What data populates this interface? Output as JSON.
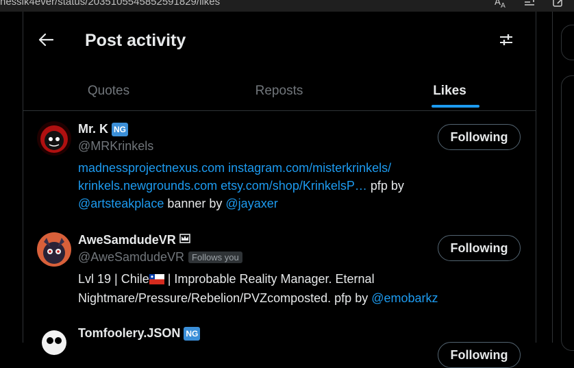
{
  "browser": {
    "url": "nessik4ever/status/2035105545852591829/likes",
    "icons": [
      "translate-icon",
      "read-aloud-icon",
      "edit-icon"
    ]
  },
  "header": {
    "title": "Post activity",
    "back_icon": "arrow-left-icon",
    "filter_icon": "sliders-icon"
  },
  "tabs": [
    {
      "label": "Quotes",
      "active": false
    },
    {
      "label": "Reposts",
      "active": false
    },
    {
      "label": "Likes",
      "active": true
    }
  ],
  "colors": {
    "accent": "#1d9bf0",
    "badge": "#3b8fd8",
    "background": "#000000"
  },
  "users": [
    {
      "name": "Mr. K",
      "badge": "NG",
      "handle": "@MRKrinkels",
      "button": "Following",
      "bio": {
        "link1": "madnessprojectnexus.com",
        "link2": "instagram.com/misterkrinkels/",
        "link3": "krinkels.newgrounds.com",
        "link4": "etsy.com/shop/KrinkelsP…",
        "text1": " pfp by",
        "mention1": "@artsteakplace",
        "text2": " banner by ",
        "mention2": "@jayaxer"
      }
    },
    {
      "name": "AweSamdudeVR",
      "badge_icon": "crown-icon",
      "handle": "@AweSamdudeVR",
      "follows_you": "Follows you",
      "button": "Following",
      "bio": {
        "text1": "Lvl 19 | Chile",
        "flag": "chile-flag-icon",
        "text2": " | Improbable Reality Manager. Eternal Nightmare/Pressure/Rebelion/PVZcomposted. pfp by ",
        "mention1": "@emobarkz"
      }
    },
    {
      "name": "Tomfoolery.JSON",
      "badge": "NG",
      "button": "Following"
    }
  ]
}
